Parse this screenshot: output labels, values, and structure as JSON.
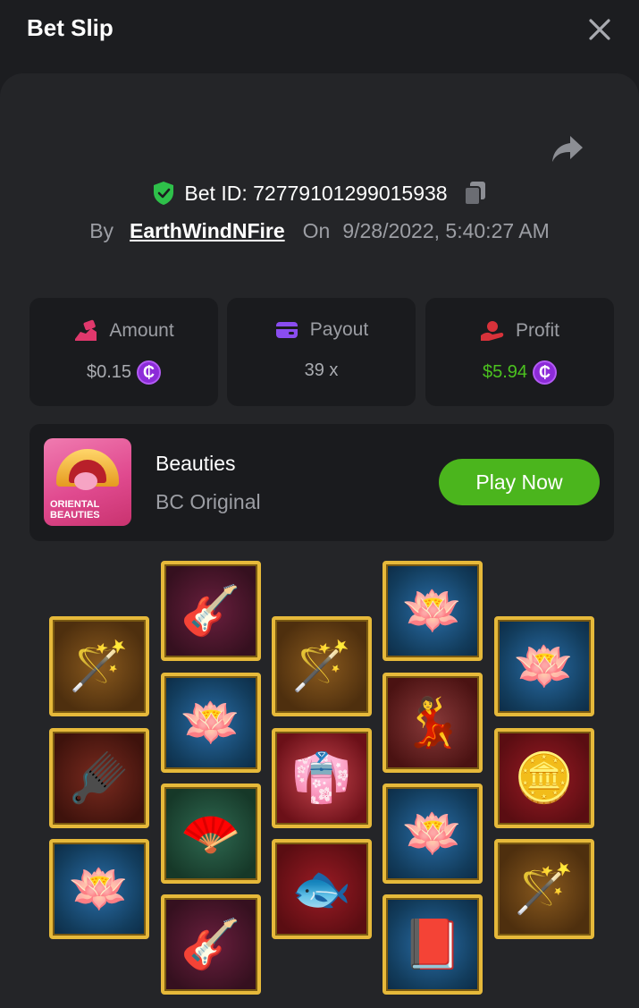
{
  "header": {
    "title": "Bet Slip",
    "close_icon": "close-icon"
  },
  "bet": {
    "id_text": "Bet ID: 72779101299015938",
    "by_label": "By",
    "username": "EarthWindNFire",
    "on_label": "On",
    "datetime": "9/28/2022, 5:40:27 AM"
  },
  "stats": {
    "amount": {
      "label": "Amount",
      "value": "$0.15",
      "icon": "bet-hand-icon",
      "icon_color": "#e0386c"
    },
    "payout": {
      "label": "Payout",
      "value": "39 x",
      "icon": "wallet-icon",
      "icon_color": "#8a4df0"
    },
    "profit": {
      "label": "Profit",
      "value": "$5.94",
      "icon": "profit-hand-icon",
      "icon_color": "#d8323a",
      "value_color": "#4bc21f"
    },
    "coin_symbol": "₵"
  },
  "game": {
    "thumb_text_1": "ORIENTAL",
    "thumb_text_2": "BEAUTIES",
    "name": "Beauties",
    "provider": "BC Original",
    "play_label": "Play Now"
  },
  "reels": [
    {
      "column": 1,
      "symbols": [
        "ruyi-scepter",
        "golden-comb",
        "blue-lotus"
      ]
    },
    {
      "column": 2,
      "symbols": [
        "pipa-lute",
        "blue-lotus",
        "jade-fan-mirror",
        "pipa-lute"
      ]
    },
    {
      "column": 3,
      "symbols": [
        "ruyi-scepter",
        "beauty-lady-red",
        "koi-fish-scroll"
      ]
    },
    {
      "column": 4,
      "symbols": [
        "blue-lotus",
        "beauty-lady-bare",
        "blue-lotus",
        "red-book"
      ]
    },
    {
      "column": 5,
      "symbols": [
        "blue-lotus",
        "gold-ingots",
        "ruyi-scepter"
      ]
    }
  ],
  "colors": {
    "background": "#1c1d20",
    "panel": "#242528",
    "card": "#1a1b1e",
    "accent_green": "#4bb51d",
    "shield_green": "#2ec04a",
    "coin_purple": "#8c2bd8",
    "reel_border_gold": "#e6b93a"
  }
}
